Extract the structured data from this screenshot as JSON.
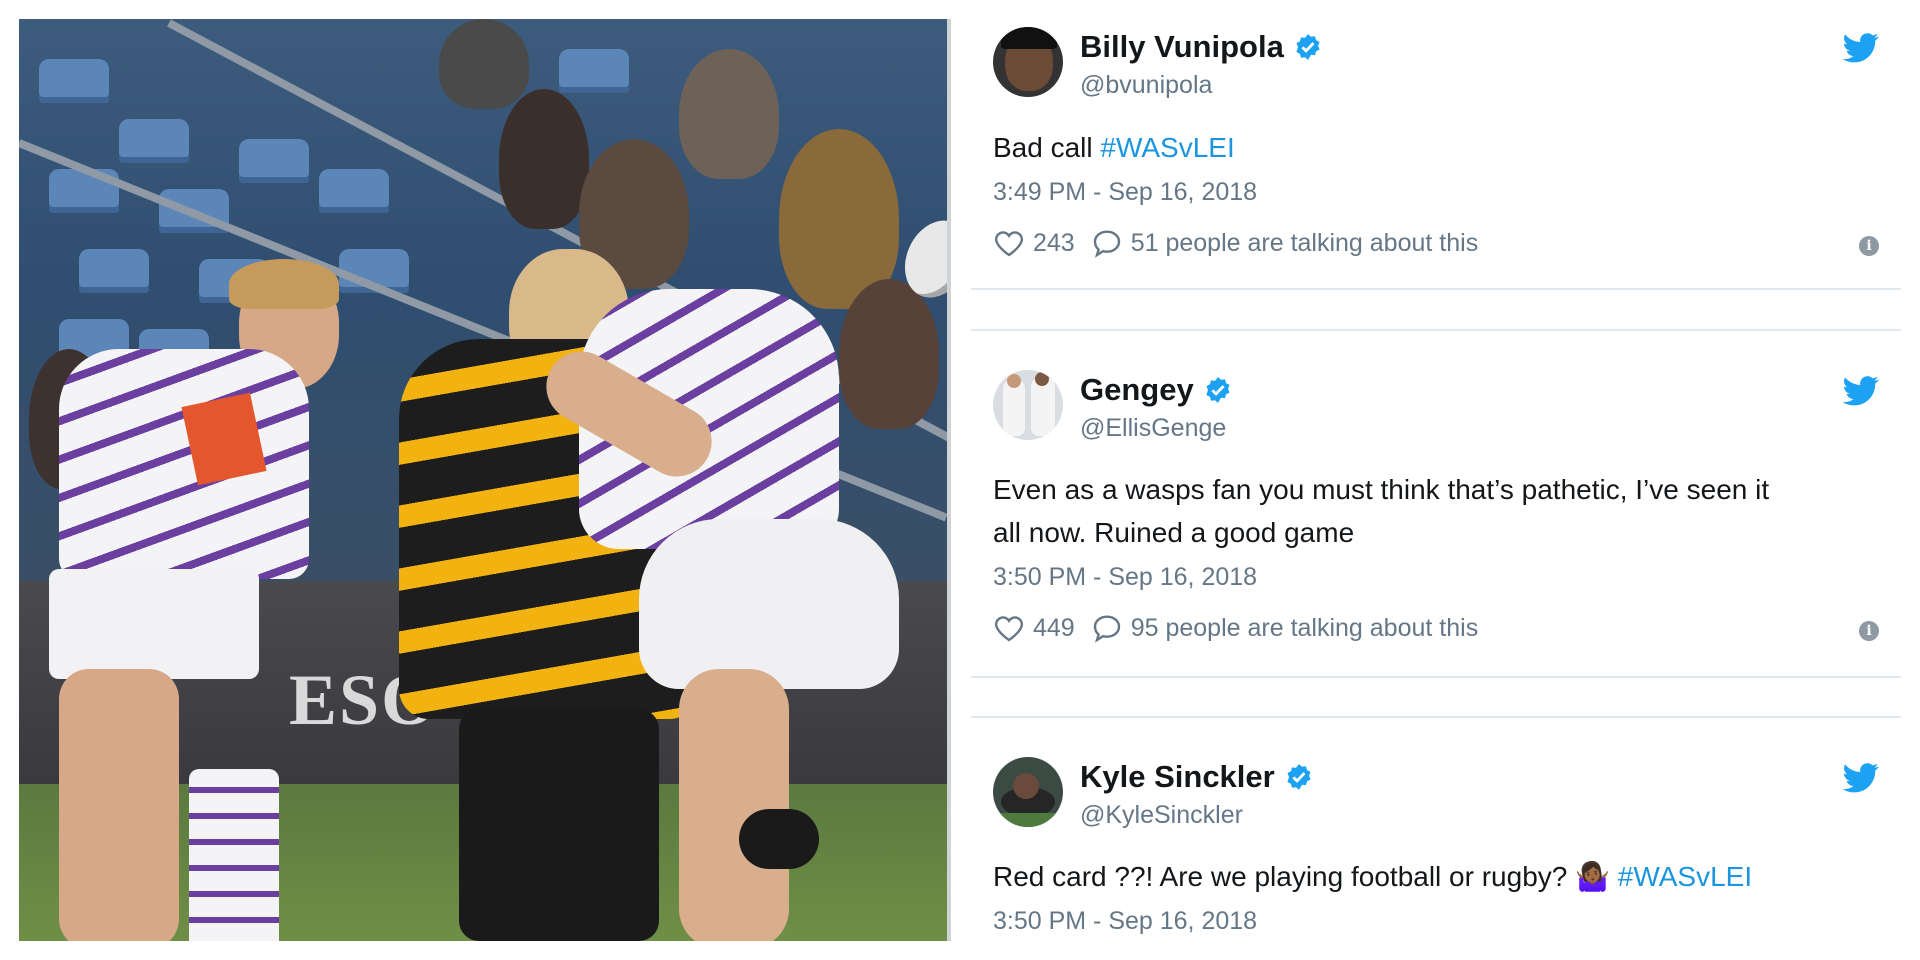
{
  "colors": {
    "twitter_blue": "#1da1f2",
    "hashtag": "#1b95e0",
    "secondary_text": "#657786",
    "primary_text": "#14171a",
    "separator": "#e1e8ed"
  },
  "photo": {
    "ad_board_text": "ESO"
  },
  "tweets": [
    {
      "name": "Billy Vunipola",
      "handle": "@bvunipola",
      "text_plain": "Bad call ",
      "hashtag": "#WASvLEI",
      "time": "3:49 PM - Sep 16, 2018",
      "likes": "243",
      "talking": "51 people are talking about this",
      "icons": [
        "avatar",
        "verified-badge-icon",
        "twitter-bird-icon",
        "heart-icon",
        "comment-icon",
        "info-icon"
      ]
    },
    {
      "name": "Gengey",
      "handle": "@EllisGenge",
      "text_line1": "Even as a wasps fan you must think that’s pathetic, I’ve seen it",
      "text_line2": "all now. Ruined a good game",
      "time": "3:50 PM - Sep 16, 2018",
      "likes": "449",
      "talking": "95 people are talking about this",
      "icons": [
        "avatar",
        "verified-badge-icon",
        "twitter-bird-icon",
        "heart-icon",
        "comment-icon",
        "info-icon"
      ]
    },
    {
      "name": "Kyle Sinckler",
      "handle": "@KyleSinckler",
      "text_plain": "Red card ??! Are we playing football or rugby? ",
      "emoji": "🤷🏾‍♀️",
      "hashtag": "#WASvLEI",
      "time": "3:50 PM - Sep 16, 2018",
      "icons": [
        "avatar",
        "verified-badge-icon",
        "twitter-bird-icon"
      ]
    }
  ]
}
